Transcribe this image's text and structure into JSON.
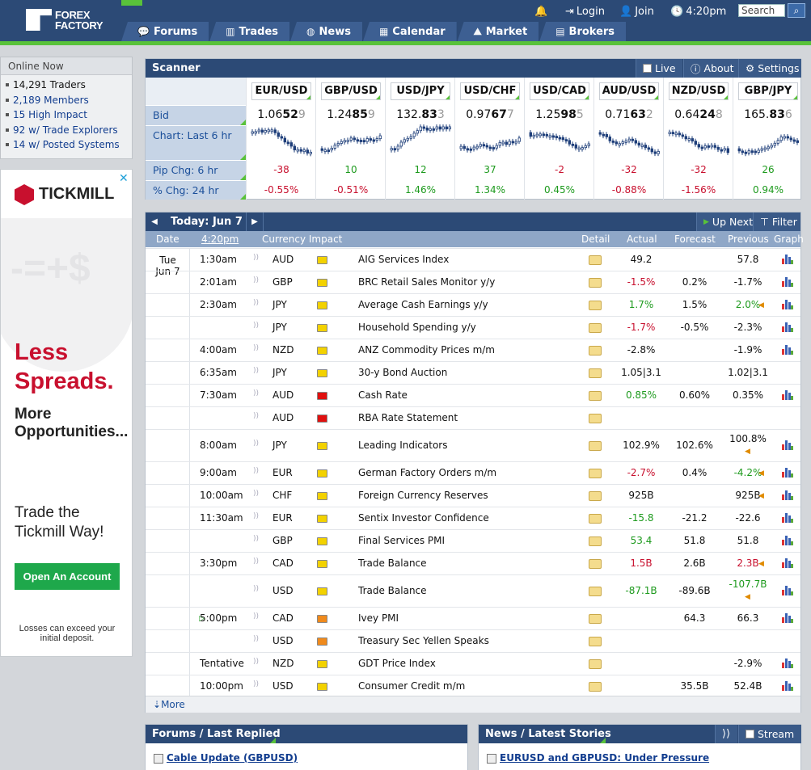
{
  "header": {
    "logo_line1": "FOREX",
    "logo_line2": "FACTORY",
    "login": "Login",
    "join": "Join",
    "time": "4:20pm",
    "search_placeholder": "Search",
    "nav": [
      "Forums",
      "Trades",
      "News",
      "Calendar",
      "Market",
      "Brokers"
    ]
  },
  "online": {
    "title": "Online Now",
    "items": [
      "14,291 Traders",
      "2,189 Members",
      "15 High Impact",
      "92 w/ Trade Explorers",
      "14 w/ Posted Systems"
    ]
  },
  "ad": {
    "brand": "TICKMILL",
    "headline1": "Less",
    "headline2": "Spreads.",
    "sub1": "More",
    "sub2": "Opportunities...",
    "tag1": "Trade the",
    "tag2": "Tickmill Way!",
    "cta": "Open An Account",
    "disclaimer": "Losses can exceed your initial deposit."
  },
  "scanner": {
    "title": "Scanner",
    "live": "Live",
    "about": "About",
    "settings": "Settings",
    "row_bid": "Bid",
    "row_chart": "Chart: Last 6 hr",
    "row_pip": "Pip Chg: 6 hr",
    "row_pct": "% Chg: 24 hr",
    "pairs": [
      {
        "pair": "EUR/USD",
        "bid_a": "1.06",
        "bid_b": "52",
        "bid_c": "9",
        "pip": "-38",
        "pct": "-0.55%"
      },
      {
        "pair": "GBP/USD",
        "bid_a": "1.24",
        "bid_b": "85",
        "bid_c": "9",
        "pip": "10",
        "pct": "-0.51%"
      },
      {
        "pair": "USD/JPY",
        "bid_a": "132.",
        "bid_b": "83",
        "bid_c": "3",
        "pip": "12",
        "pct": "1.46%"
      },
      {
        "pair": "USD/CHF",
        "bid_a": "0.97",
        "bid_b": "67",
        "bid_c": "7",
        "pip": "37",
        "pct": "1.34%"
      },
      {
        "pair": "USD/CAD",
        "bid_a": "1.25",
        "bid_b": "98",
        "bid_c": "5",
        "pip": "-2",
        "pct": "0.45%"
      },
      {
        "pair": "AUD/USD",
        "bid_a": "0.71",
        "bid_b": "63",
        "bid_c": "2",
        "pip": "-32",
        "pct": "-0.88%"
      },
      {
        "pair": "NZD/USD",
        "bid_a": "0.64",
        "bid_b": "24",
        "bid_c": "8",
        "pip": "-32",
        "pct": "-1.56%"
      },
      {
        "pair": "GBP/JPY",
        "bid_a": "165.",
        "bid_b": "83",
        "bid_c": "6",
        "pip": "26",
        "pct": "0.94%"
      }
    ]
  },
  "calendar": {
    "today_label": "Today: Jun 7",
    "up_next": "Up Next",
    "filter": "Filter",
    "columns": {
      "date": "Date",
      "time": "4:20pm",
      "currency_impact": "Currency Impact",
      "detail": "Detail",
      "actual": "Actual",
      "forecast": "Forecast",
      "previous": "Previous",
      "graph": "Graph"
    },
    "day_label_1": "Tue",
    "day_label_2": "Jun 7",
    "rows": [
      {
        "time": "1:30am",
        "cur": "AUD",
        "imp": "y",
        "event": "AIG Services Index",
        "actual": "49.2",
        "act_c": "",
        "forecast": "",
        "previous": "57.8",
        "prev_c": "",
        "graph": true
      },
      {
        "time": "2:01am",
        "cur": "GBP",
        "imp": "y",
        "event": "BRC Retail Sales Monitor y/y",
        "actual": "-1.5%",
        "act_c": "neg",
        "forecast": "0.2%",
        "previous": "-1.7%",
        "prev_c": "",
        "graph": true
      },
      {
        "time": "2:30am",
        "cur": "JPY",
        "imp": "y",
        "event": "Average Cash Earnings y/y",
        "actual": "1.7%",
        "act_c": "pos",
        "forecast": "1.5%",
        "previous": "2.0%",
        "prev_c": "pos",
        "rev": true,
        "graph": true
      },
      {
        "time": "",
        "cur": "JPY",
        "imp": "y",
        "event": "Household Spending y/y",
        "actual": "-1.7%",
        "act_c": "neg",
        "forecast": "-0.5%",
        "previous": "-2.3%",
        "prev_c": "",
        "graph": true
      },
      {
        "time": "4:00am",
        "cur": "NZD",
        "imp": "y",
        "event": "ANZ Commodity Prices m/m",
        "actual": "-2.8%",
        "act_c": "",
        "forecast": "",
        "previous": "-1.9%",
        "prev_c": "",
        "graph": true
      },
      {
        "time": "6:35am",
        "cur": "JPY",
        "imp": "y",
        "event": "30-y Bond Auction",
        "actual": "1.05|3.1",
        "act_c": "",
        "forecast": "",
        "previous": "1.02|3.1",
        "prev_c": "",
        "graph": false
      },
      {
        "time": "7:30am",
        "cur": "AUD",
        "imp": "r",
        "event": "Cash Rate",
        "actual": "0.85%",
        "act_c": "pos",
        "forecast": "0.60%",
        "previous": "0.35%",
        "prev_c": "",
        "graph": true
      },
      {
        "time": "",
        "cur": "AUD",
        "imp": "r",
        "event": "RBA Rate Statement",
        "actual": "",
        "act_c": "",
        "forecast": "",
        "previous": "",
        "prev_c": "",
        "graph": false
      },
      {
        "time": "8:00am",
        "cur": "JPY",
        "imp": "y",
        "event": "Leading Indicators",
        "actual": "102.9%",
        "act_c": "",
        "forecast": "102.6%",
        "previous": "100.8%",
        "prev_c": "",
        "rev": true,
        "tall": true,
        "graph": true
      },
      {
        "time": "9:00am",
        "cur": "EUR",
        "imp": "y",
        "event": "German Factory Orders m/m",
        "actual": "-2.7%",
        "act_c": "neg",
        "forecast": "0.4%",
        "previous": "-4.2%",
        "prev_c": "pos",
        "rev": true,
        "graph": true
      },
      {
        "time": "10:00am",
        "cur": "CHF",
        "imp": "y",
        "event": "Foreign Currency Reserves",
        "actual": "925B",
        "act_c": "",
        "forecast": "",
        "previous": "925B",
        "prev_c": "",
        "rev": true,
        "graph": true
      },
      {
        "time": "11:30am",
        "cur": "EUR",
        "imp": "y",
        "event": "Sentix Investor Confidence",
        "actual": "-15.8",
        "act_c": "pos",
        "forecast": "-21.2",
        "previous": "-22.6",
        "prev_c": "",
        "graph": true
      },
      {
        "time": "",
        "cur": "GBP",
        "imp": "y",
        "event": "Final Services PMI",
        "actual": "53.4",
        "act_c": "pos",
        "forecast": "51.8",
        "previous": "51.8",
        "prev_c": "",
        "graph": true
      },
      {
        "time": "3:30pm",
        "cur": "CAD",
        "imp": "y",
        "event": "Trade Balance",
        "actual": "1.5B",
        "act_c": "neg",
        "forecast": "2.6B",
        "previous": "2.3B",
        "prev_c": "neg",
        "rev": true,
        "graph": true
      },
      {
        "time": "",
        "cur": "USD",
        "imp": "y",
        "event": "Trade Balance",
        "actual": "-87.1B",
        "act_c": "pos",
        "forecast": "-89.6B",
        "previous": "-107.7B",
        "prev_c": "pos",
        "rev": true,
        "tall": true,
        "graph": true
      },
      {
        "time": "5:00pm",
        "cur": "CAD",
        "imp": "o",
        "event": "Ivey PMI",
        "actual": "",
        "act_c": "",
        "forecast": "64.3",
        "previous": "66.3",
        "prev_c": "",
        "next": true,
        "graph": true
      },
      {
        "time": "",
        "cur": "USD",
        "imp": "o",
        "event": "Treasury Sec Yellen Speaks",
        "actual": "",
        "act_c": "",
        "forecast": "",
        "previous": "",
        "prev_c": "",
        "graph": false
      },
      {
        "time": "Tentative",
        "cur": "NZD",
        "imp": "y",
        "event": "GDT Price Index",
        "actual": "",
        "act_c": "",
        "forecast": "",
        "previous": "-2.9%",
        "prev_c": "",
        "graph": true
      },
      {
        "time": "10:00pm",
        "cur": "USD",
        "imp": "y",
        "event": "Consumer Credit m/m",
        "actual": "",
        "act_c": "",
        "forecast": "35.5B",
        "previous": "52.4B",
        "prev_c": "",
        "graph": true
      }
    ],
    "more": "More"
  },
  "forums": {
    "title": "Forums / Last Replied",
    "first_link": "Cable Update (GBPUSD)"
  },
  "news": {
    "title": "News / Latest Stories",
    "stream": "Stream",
    "first_link": "EURUSD and GBPUSD: Under Pressure"
  },
  "colors": {
    "header_bg": "#2c4a76",
    "accent_green": "#59c23a",
    "negative": "#c8102e",
    "positive": "#1d9a1d",
    "ad_red": "#c8102e",
    "cta_green": "#1ea84b"
  }
}
